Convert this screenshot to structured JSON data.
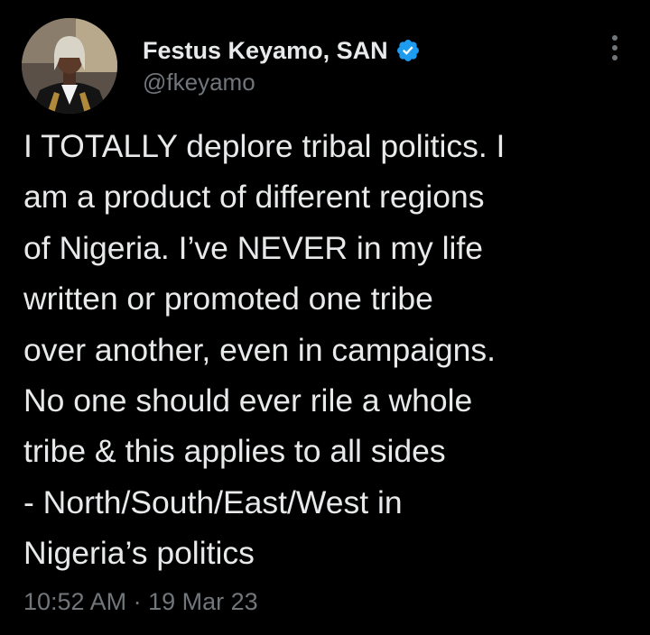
{
  "tweet": {
    "author": {
      "name": "Festus Keyamo, SAN",
      "handle": "@fkeyamo",
      "verified": true,
      "avatar": "profile-photo"
    },
    "text": "I TOTALLY deplore tribal politics. I\nam a product of different regions\nof Nigeria. I’ve NEVER in my life\nwritten or promoted one tribe\nover another, even in campaigns.\nNo one should ever rile a whole\ntribe & this applies to all sides\n- North/South/East/West in\nNigeria’s politics",
    "time": "10:52 AM",
    "separator": "·",
    "date": "19 Mar 23"
  },
  "icons": {
    "verified": "verified-badge-icon",
    "more": "more-vertical-icon"
  },
  "colors": {
    "background": "#000000",
    "primary_text": "#e7e9ea",
    "secondary_text": "#71767b",
    "verified_blue": "#1d9bf0"
  }
}
